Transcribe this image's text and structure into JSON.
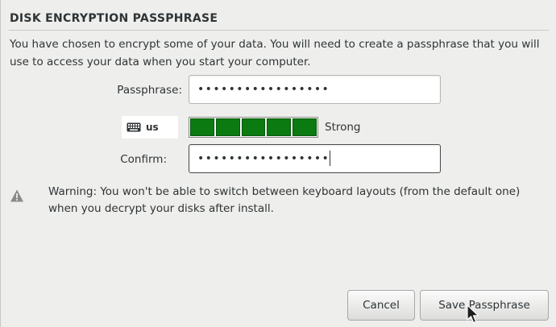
{
  "dialog": {
    "title": "DISK ENCRYPTION PASSPHRASE",
    "intro": "You have chosen to encrypt some of your data. You will need to create a passphrase that you will use to access your data when you start your computer."
  },
  "passphrase": {
    "label": "Passphrase:",
    "value": "•••••••••••••••••"
  },
  "keyboard_layout": {
    "icon": "keyboard-icon",
    "value": "us"
  },
  "strength": {
    "segments_filled": 5,
    "segments_total": 5,
    "label": "Strong",
    "color": "#0a7a11"
  },
  "confirm": {
    "label": "Confirm:",
    "value": "•••••••••••••••••"
  },
  "warning": {
    "icon": "warning-icon",
    "text": "Warning: You won't be able to switch between keyboard layouts (from the default one) when you decrypt your disks after install."
  },
  "buttons": {
    "cancel": "Cancel",
    "save": "Save Passphrase"
  }
}
